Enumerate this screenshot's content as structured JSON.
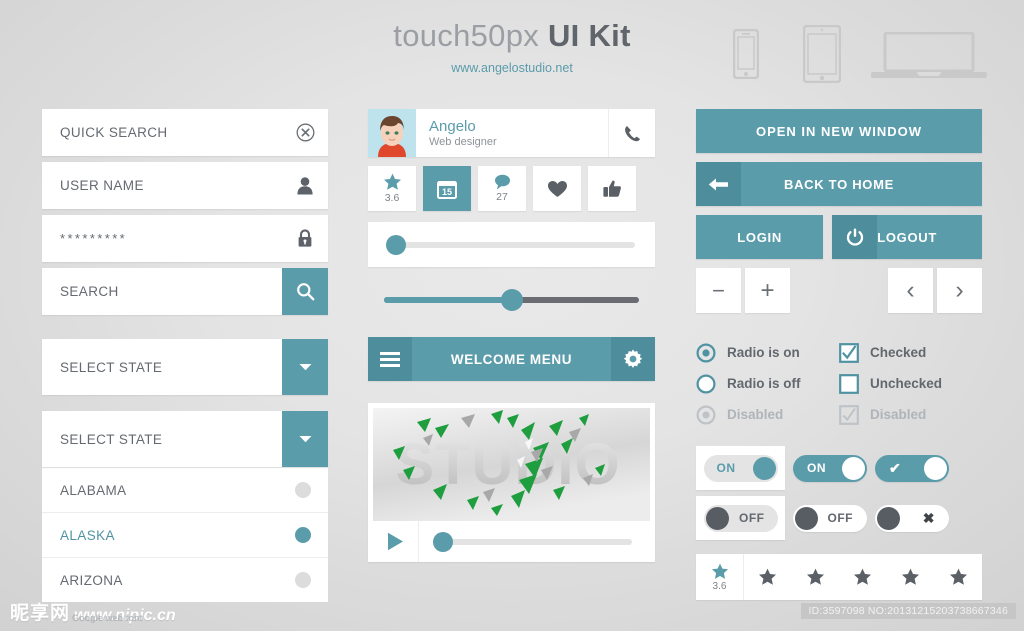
{
  "header": {
    "title_light": "touch50px",
    "title_bold": "UI Kit",
    "subtitle": "www.angelostudio.net",
    "devices": [
      "phone-icon",
      "tablet-icon",
      "laptop-icon"
    ]
  },
  "left": {
    "quick_search": {
      "label": "QUICK SEARCH",
      "icon": "circle-close-icon"
    },
    "user_name": {
      "label": "USER NAME",
      "icon": "user-icon"
    },
    "password": {
      "value": "*********",
      "icon": "lock-icon"
    },
    "search": {
      "label": "SEARCH",
      "icon": "search-icon"
    },
    "select_closed": {
      "label": "SELECT STATE",
      "icon": "caret-down-icon"
    },
    "select_open": {
      "label": "SELECT STATE",
      "icon": "caret-down-icon",
      "options": [
        {
          "label": "ALABAMA",
          "selected": false
        },
        {
          "label": "ALASKA",
          "selected": true
        },
        {
          "label": "ARIZONA",
          "selected": false
        }
      ]
    }
  },
  "middle": {
    "profile": {
      "name": "Angelo",
      "role": "Web designer",
      "action_icon": "phone-icon"
    },
    "stats": [
      {
        "icon": "star-icon",
        "value": "3.6",
        "active": false
      },
      {
        "icon": "calendar-icon",
        "value": "15",
        "active": true
      },
      {
        "icon": "comment-icon",
        "value": "27",
        "active": false
      },
      {
        "icon": "heart-icon",
        "value": "",
        "active": false
      },
      {
        "icon": "thumbs-up-icon",
        "value": "",
        "active": false
      }
    ],
    "slider_card": {
      "percent": 2
    },
    "slider_bare": {
      "percent": 50
    },
    "menu": {
      "title": "WELCOME MENU",
      "left_icon": "hamburger-icon",
      "right_icon": "gear-icon"
    },
    "video": {
      "caption": "STUDIO",
      "play_icon": "play-icon",
      "progress_percent": 3
    }
  },
  "right": {
    "open_new_window": "OPEN IN NEW WINDOW",
    "back_to_home": {
      "label": "BACK TO HOME",
      "icon": "arrow-left-icon"
    },
    "login": "LOGIN",
    "logout": {
      "label": "LOGOUT",
      "icon": "power-icon"
    },
    "steppers": [
      {
        "name": "minus-button",
        "glyph": "−"
      },
      {
        "name": "plus-button",
        "glyph": "+"
      }
    ],
    "pagers": [
      {
        "name": "prev-button",
        "glyph": "‹"
      },
      {
        "name": "next-button",
        "glyph": "›"
      }
    ],
    "radios": [
      {
        "label": "Radio is on",
        "state": "on"
      },
      {
        "label": "Radio is off",
        "state": "off"
      },
      {
        "label": "Disabled",
        "state": "disabled"
      }
    ],
    "checkboxes": [
      {
        "label": "Checked",
        "state": "checked"
      },
      {
        "label": "Unchecked",
        "state": "unchecked"
      },
      {
        "label": "Disabled",
        "state": "disabled"
      }
    ],
    "toggles_on": [
      {
        "label": "ON",
        "style": "card-light"
      },
      {
        "label": "ON",
        "style": "teal"
      },
      {
        "label": "✔",
        "style": "teal-check"
      }
    ],
    "toggles_off": [
      {
        "label": "OFF",
        "style": "card-light"
      },
      {
        "label": "OFF",
        "style": "white"
      },
      {
        "label": "✖",
        "style": "white-cross"
      }
    ],
    "rating": {
      "value": "3.6",
      "filled": 1,
      "total": 6
    }
  },
  "footer": {
    "watermark_cn": "昵享网",
    "watermark_url": "www.nipic.cn",
    "id_badge": "ID:3597098 NO:20131215203738667346",
    "fine_print": "Google web font"
  },
  "colors": {
    "teal": "#5b9cab",
    "teal_dark": "#4e8d9c",
    "text": "#63686e",
    "muted": "#b0b4b8",
    "background": "#e4e4e4"
  }
}
